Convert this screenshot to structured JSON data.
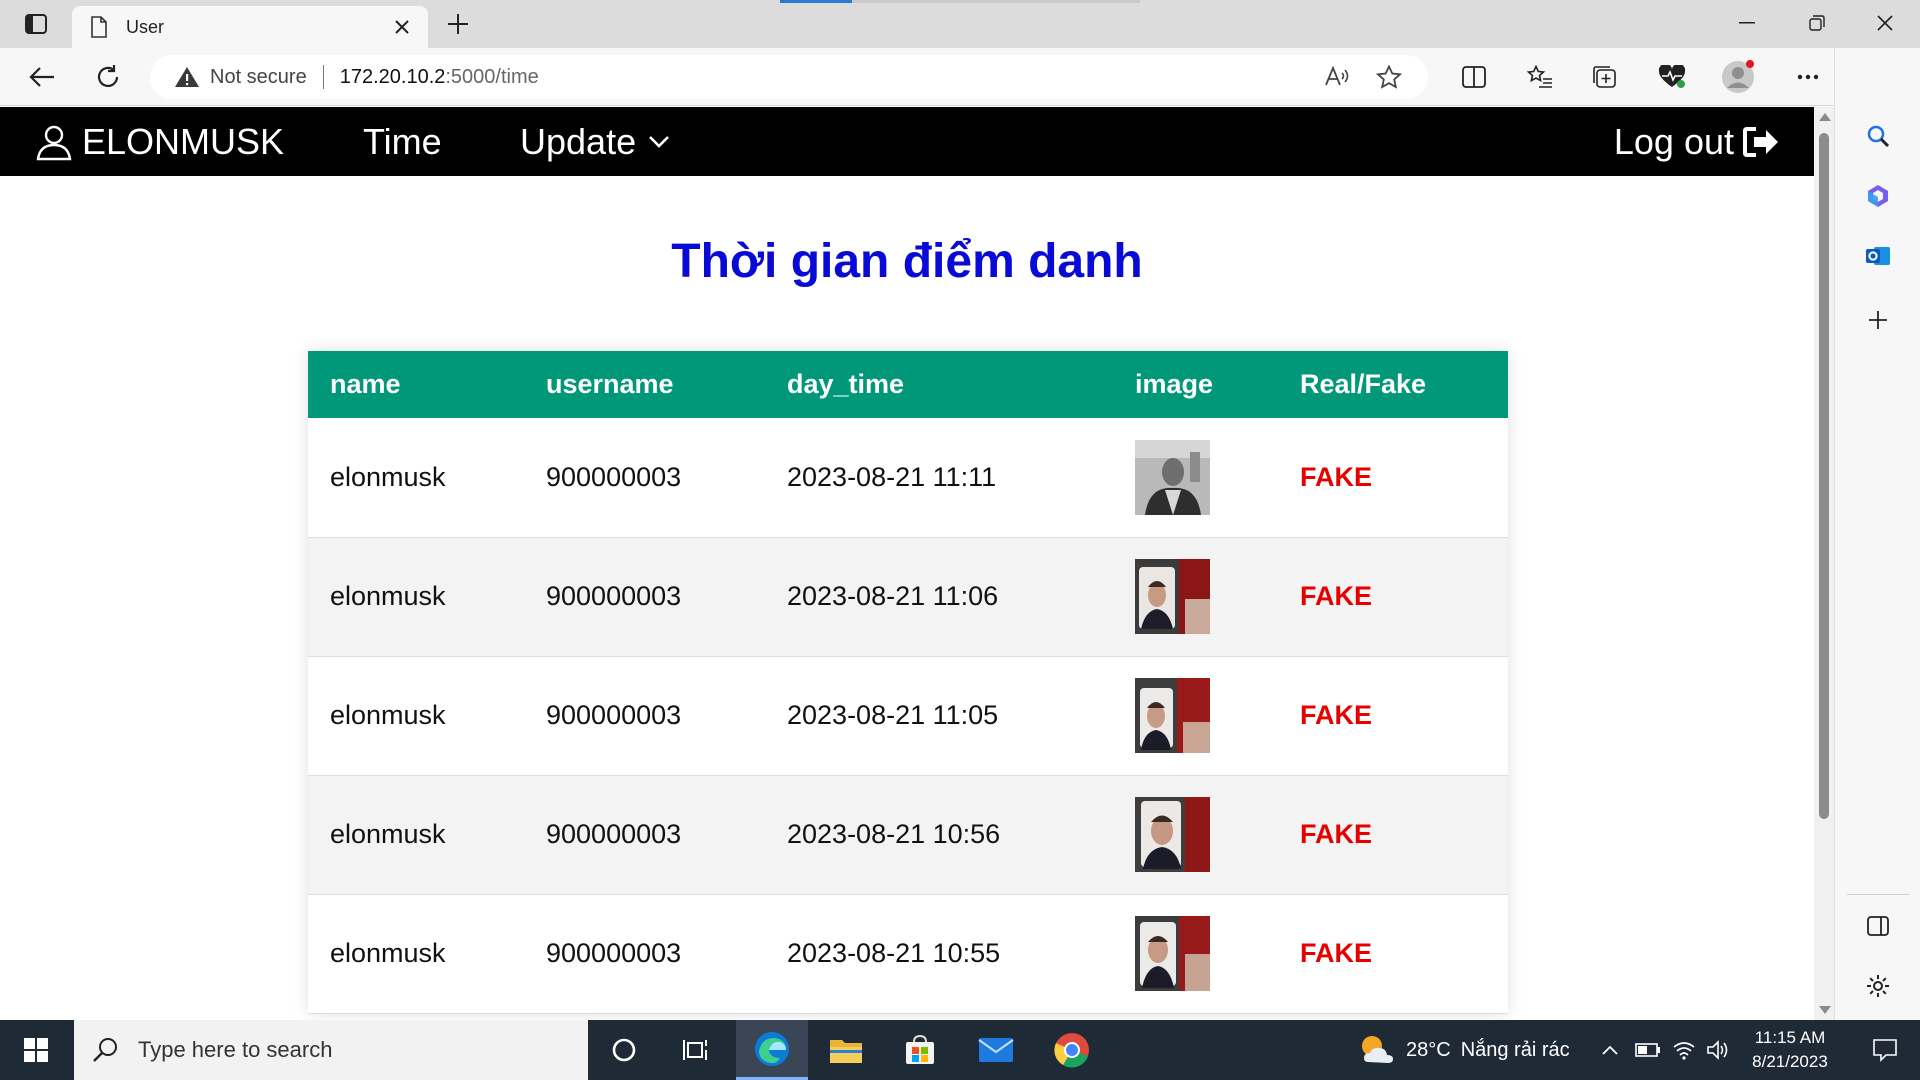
{
  "browser": {
    "tab": {
      "title": "User"
    },
    "address": {
      "security_label": "Not secure",
      "url_host": "172.20.10.2",
      "url_path": ":5000/time"
    }
  },
  "navbar": {
    "brand": "ELONMUSK",
    "time": "Time",
    "update": "Update",
    "logout": "Log out"
  },
  "page": {
    "title": "Thời gian điểm danh"
  },
  "table": {
    "headers": [
      "name",
      "username",
      "day_time",
      "image",
      "Real/Fake"
    ],
    "rows": [
      {
        "name": "elonmusk",
        "username": "900000003",
        "day_time": "2023-08-21 11:11",
        "status": "FAKE"
      },
      {
        "name": "elonmusk",
        "username": "900000003",
        "day_time": "2023-08-21 11:06",
        "status": "FAKE"
      },
      {
        "name": "elonmusk",
        "username": "900000003",
        "day_time": "2023-08-21 11:05",
        "status": "FAKE"
      },
      {
        "name": "elonmusk",
        "username": "900000003",
        "day_time": "2023-08-21 10:56",
        "status": "FAKE"
      },
      {
        "name": "elonmusk",
        "username": "900000003",
        "day_time": "2023-08-21 10:55",
        "status": "FAKE"
      }
    ]
  },
  "taskbar": {
    "search_placeholder": "Type here to search",
    "weather_temp": "28°C",
    "weather_desc": "Nắng rải rác",
    "time": "11:15 AM",
    "date": "8/21/2023"
  },
  "colors": {
    "header_green": "#009879",
    "title_blue": "#0a0ad6",
    "fake_red": "#e60000",
    "navbar_bg": "#000000"
  }
}
